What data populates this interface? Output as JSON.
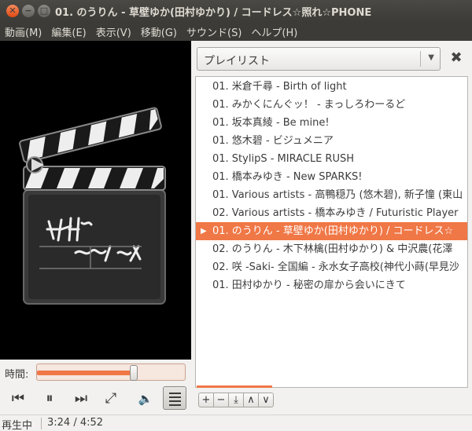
{
  "window": {
    "title": "01. のうりん - 草壁ゆか(田村ゆかり) / コードレス☆照れ☆PHONE",
    "close_glyph": "✕",
    "min_glyph": "−",
    "max_glyph": "□"
  },
  "menu": [
    "動画(M)",
    "編集(E)",
    "表示(V)",
    "移動(G)",
    "サウンド(S)",
    "ヘルプ(H)"
  ],
  "playlist": {
    "combo_label": "プレイリスト",
    "close_glyph": "✖",
    "playing_index": 8,
    "items": [
      "01. 米倉千尋 - Birth of light",
      "01. みかくにんぐッ！ - まっしろわーるど",
      "01. 坂本真綾 - Be mine!",
      "01. 悠木碧 - ビジュメニア",
      "01. StylipS - MIRACLE RUSH",
      "01. 橋本みゆき - New SPARKS!",
      "01. Various artists - 高鴨穏乃 (悠木碧), 新子憧 (東山",
      "02. Various artists - 橋本みゆき / Futuristic Player",
      "01. のうりん - 草壁ゆか(田村ゆかり) / コードレス☆",
      "02. のうりん - 木下林檎(田村ゆかり) & 中沢農(花澤",
      "02. 咲 -Saki- 全国編 - 永水女子高校(神代小蒔(早見沙",
      "01. 田村ゆかり - 秘密の扉から会いにきて"
    ],
    "tools": [
      "+",
      "−",
      "⤓",
      "∧",
      "∨"
    ]
  },
  "seek": {
    "label": "時間:",
    "position": 0.66
  },
  "controls": {
    "prev": "⏮",
    "pause": "⏸",
    "next": "⏭",
    "fullscreen": "⤢",
    "volume": "🔈"
  },
  "status": {
    "state": "再生中",
    "time": "3:24 / 4:52"
  },
  "colors": {
    "accent": "#f07746",
    "titlebar": "#3c3b37"
  }
}
